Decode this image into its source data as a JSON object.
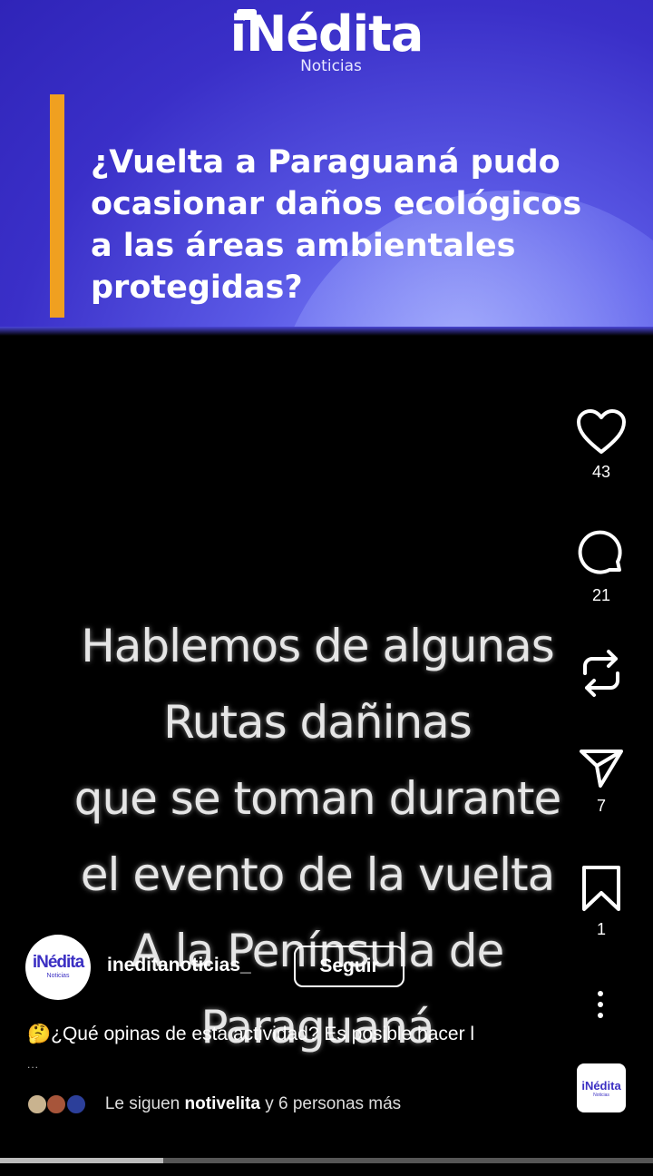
{
  "banner": {
    "logo_word": "iNédita",
    "logo_sub": "Noticias",
    "headline": "¿Vuelta a Paraguaná pudo\nocasionar daños ecológicos\na las áreas ambientales\nprotegidas?"
  },
  "video_overlay_text": "Hablemos de algunas\nRutas dañinas\nque se toman durante\nel evento de la vuelta\nA la Península de\nParaguaná",
  "actions": {
    "likes": "43",
    "comments": "21",
    "shares": "7",
    "saves": "1"
  },
  "account": {
    "avatar_word": "iNédita",
    "avatar_sub": "Noticias",
    "username": "ineditanoticias_",
    "follow_label": "Seguir"
  },
  "caption": {
    "text": "🤔¿Qué opinas de esta actividad? Es posible hacer l",
    "more": "..."
  },
  "followed_by": {
    "prefix": "Le siguen",
    "name": "notivelita",
    "suffix": "y 6 personas más"
  },
  "audio_thumb": {
    "word": "iNédita",
    "sub": "Noticias"
  },
  "progress": 0.25,
  "colors": {
    "banner_bg": "#3a2fc8",
    "accent": "#f0a020",
    "brand": "#3b2fc3"
  }
}
